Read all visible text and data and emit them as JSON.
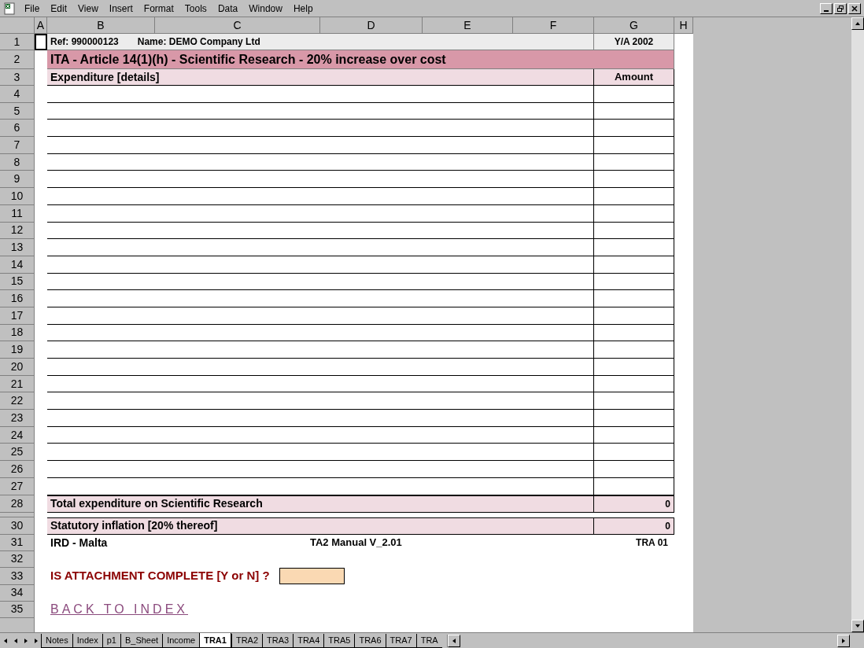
{
  "menu": [
    "File",
    "Edit",
    "View",
    "Insert",
    "Format",
    "Tools",
    "Data",
    "Window",
    "Help"
  ],
  "columns": [
    "A",
    "B",
    "C",
    "D",
    "E",
    "F",
    "G",
    "H"
  ],
  "rows": [
    {
      "number": "1",
      "kind": "info",
      "a_selected": true,
      "ref": "Ref:  990000123",
      "name": "Name: DEMO Company Ltd",
      "year": "Y/A 2002"
    },
    {
      "number": "2",
      "kind": "title",
      "a_selected": false,
      "text": "ITA - Article 14(1)(h) - Scientific Research - 20% increase over cost"
    },
    {
      "number": "3",
      "kind": "heads",
      "a_selected": false,
      "label": "Expenditure [details]",
      "amount": "Amount"
    },
    {
      "number": "4",
      "kind": "entry",
      "a_selected": false
    },
    {
      "number": "5",
      "kind": "entry",
      "a_selected": false
    },
    {
      "number": "6",
      "kind": "entry",
      "a_selected": false
    },
    {
      "number": "7",
      "kind": "entry",
      "a_selected": false
    },
    {
      "number": "8",
      "kind": "entry",
      "a_selected": false
    },
    {
      "number": "9",
      "kind": "entry",
      "a_selected": false
    },
    {
      "number": "10",
      "kind": "entry",
      "a_selected": false
    },
    {
      "number": "11",
      "kind": "entry",
      "a_selected": false
    },
    {
      "number": "12",
      "kind": "entry",
      "a_selected": false
    },
    {
      "number": "13",
      "kind": "entry",
      "a_selected": false
    },
    {
      "number": "14",
      "kind": "entry",
      "a_selected": false
    },
    {
      "number": "15",
      "kind": "entry",
      "a_selected": false
    },
    {
      "number": "16",
      "kind": "entry",
      "a_selected": false
    },
    {
      "number": "17",
      "kind": "entry",
      "a_selected": false
    },
    {
      "number": "18",
      "kind": "entry",
      "a_selected": false
    },
    {
      "number": "19",
      "kind": "entry",
      "a_selected": false
    },
    {
      "number": "20",
      "kind": "entry",
      "a_selected": false
    },
    {
      "number": "21",
      "kind": "entry",
      "a_selected": false
    },
    {
      "number": "22",
      "kind": "entry",
      "a_selected": false
    },
    {
      "number": "23",
      "kind": "entry",
      "a_selected": false
    },
    {
      "number": "24",
      "kind": "entry",
      "a_selected": false
    },
    {
      "number": "25",
      "kind": "entry",
      "a_selected": false
    },
    {
      "number": "26",
      "kind": "entry",
      "a_selected": false
    },
    {
      "number": "27",
      "kind": "entry",
      "a_selected": false
    },
    {
      "number": "28",
      "kind": "total",
      "a_selected": false,
      "label": "Total expenditure on Scientific Research",
      "amount": "0"
    },
    {
      "kind": "spacer",
      "a_selected": false
    },
    {
      "number": "30",
      "kind": "total",
      "a_selected": false,
      "label": "Statutory inflation [20% thereof]",
      "amount": "0"
    },
    {
      "number": "31",
      "kind": "footer",
      "a_selected": false,
      "left": "IRD - Malta",
      "middle": "TA2 Manual V_2.01",
      "right": "TRA 01"
    },
    {
      "number": "32",
      "kind": "blank",
      "a_selected": false
    },
    {
      "number": "33",
      "kind": "question",
      "a_selected": false,
      "label": "IS ATTACHMENT COMPLETE [Y or N] ?"
    },
    {
      "number": "34",
      "kind": "blank",
      "a_selected": false
    },
    {
      "number": "35",
      "kind": "link",
      "a_selected": false,
      "text": "BACK TO INDEX"
    }
  ],
  "sheet_tabs": [
    {
      "label": "Notes",
      "selected": false
    },
    {
      "label": "Index",
      "selected": false
    },
    {
      "label": "p1",
      "selected": false
    },
    {
      "label": "B_Sheet",
      "selected": false
    },
    {
      "label": "Income",
      "selected": false
    },
    {
      "label": "TRA1",
      "selected": true
    },
    {
      "label": "TRA2",
      "selected": false
    },
    {
      "label": "TRA3",
      "selected": false
    },
    {
      "label": "TRA4",
      "selected": false
    },
    {
      "label": "TRA5",
      "selected": false
    },
    {
      "label": "TRA6",
      "selected": false
    },
    {
      "label": "TRA7",
      "selected": false
    },
    {
      "label": "TRA",
      "selected": false
    }
  ]
}
